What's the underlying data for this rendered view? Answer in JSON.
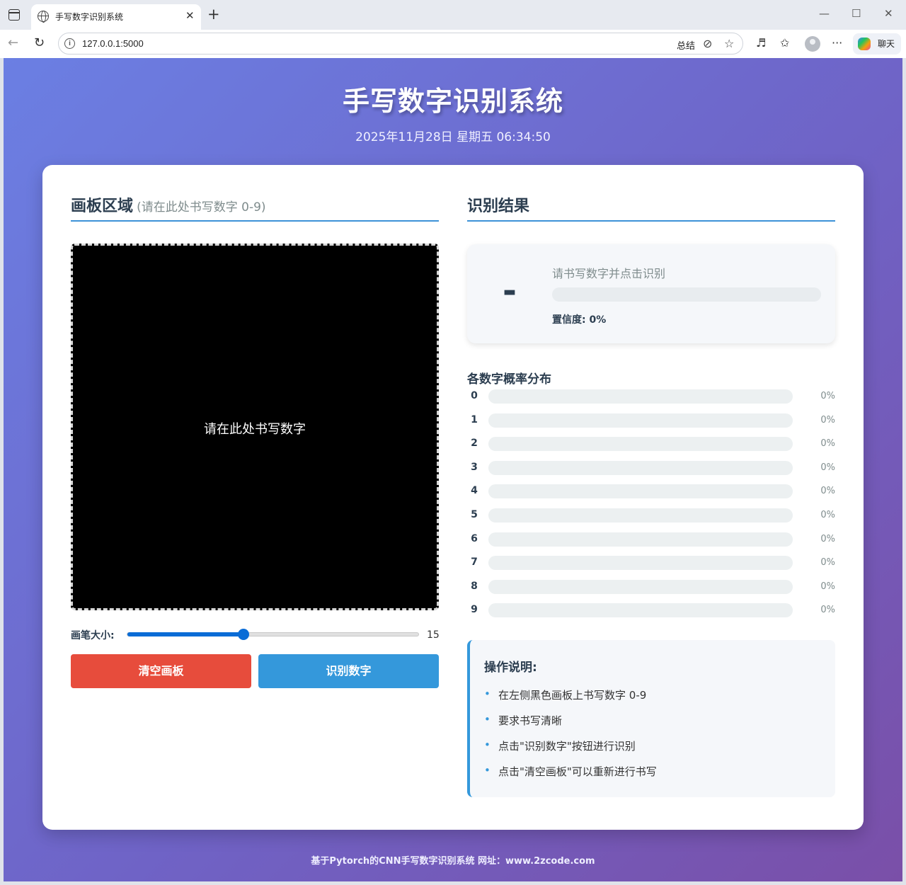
{
  "browser": {
    "tab_title": "手写数字识别系统",
    "new_tab_symbol": "+",
    "close_symbol": "✕",
    "url": "127.0.0.1:5000",
    "summary_label": "总结",
    "chat_label": "聊天",
    "window_controls": [
      "—",
      "☐",
      "✕"
    ]
  },
  "header": {
    "title": "手写数字识别系统",
    "datetime": "2025年11月28日 星期五 06:34:50"
  },
  "canvas_section": {
    "title": "画板区域",
    "subtitle": "(请在此处书写数字 0-9)",
    "hint": "请在此处书写数字",
    "brush_label": "画笔大小:",
    "brush_value": "15",
    "brush_fraction": 0.4,
    "clear_button": "清空画板",
    "recognize_button": "识别数字"
  },
  "result_section": {
    "title": "识别结果",
    "digit": "-",
    "message": "请书写数字并点击识别",
    "confidence_label": "置信度: 0%",
    "confidence": 0,
    "distribution_title": "各数字概率分布",
    "probabilities": [
      {
        "digit": "0",
        "value": "0%",
        "fraction": 0
      },
      {
        "digit": "1",
        "value": "0%",
        "fraction": 0
      },
      {
        "digit": "2",
        "value": "0%",
        "fraction": 0
      },
      {
        "digit": "3",
        "value": "0%",
        "fraction": 0
      },
      {
        "digit": "4",
        "value": "0%",
        "fraction": 0
      },
      {
        "digit": "5",
        "value": "0%",
        "fraction": 0
      },
      {
        "digit": "6",
        "value": "0%",
        "fraction": 0
      },
      {
        "digit": "7",
        "value": "0%",
        "fraction": 0
      },
      {
        "digit": "8",
        "value": "0%",
        "fraction": 0
      },
      {
        "digit": "9",
        "value": "0%",
        "fraction": 0
      }
    ]
  },
  "instructions": {
    "title": "操作说明:",
    "items": [
      "在左侧黑色画板上书写数字 0-9",
      "要求书写清晰",
      "点击\"识别数字\"按钮进行识别",
      "点击\"清空画板\"可以重新进行书写"
    ]
  },
  "footer": {
    "text": "基于Pytorch的CNN手写数字识别系统 网址：www.2zcode.com"
  },
  "colors": {
    "accent": "#3498db",
    "danger": "#e74c3c",
    "heading": "#2c3e50",
    "background_start": "#6b7fe3",
    "background_end": "#7a4fa8"
  }
}
